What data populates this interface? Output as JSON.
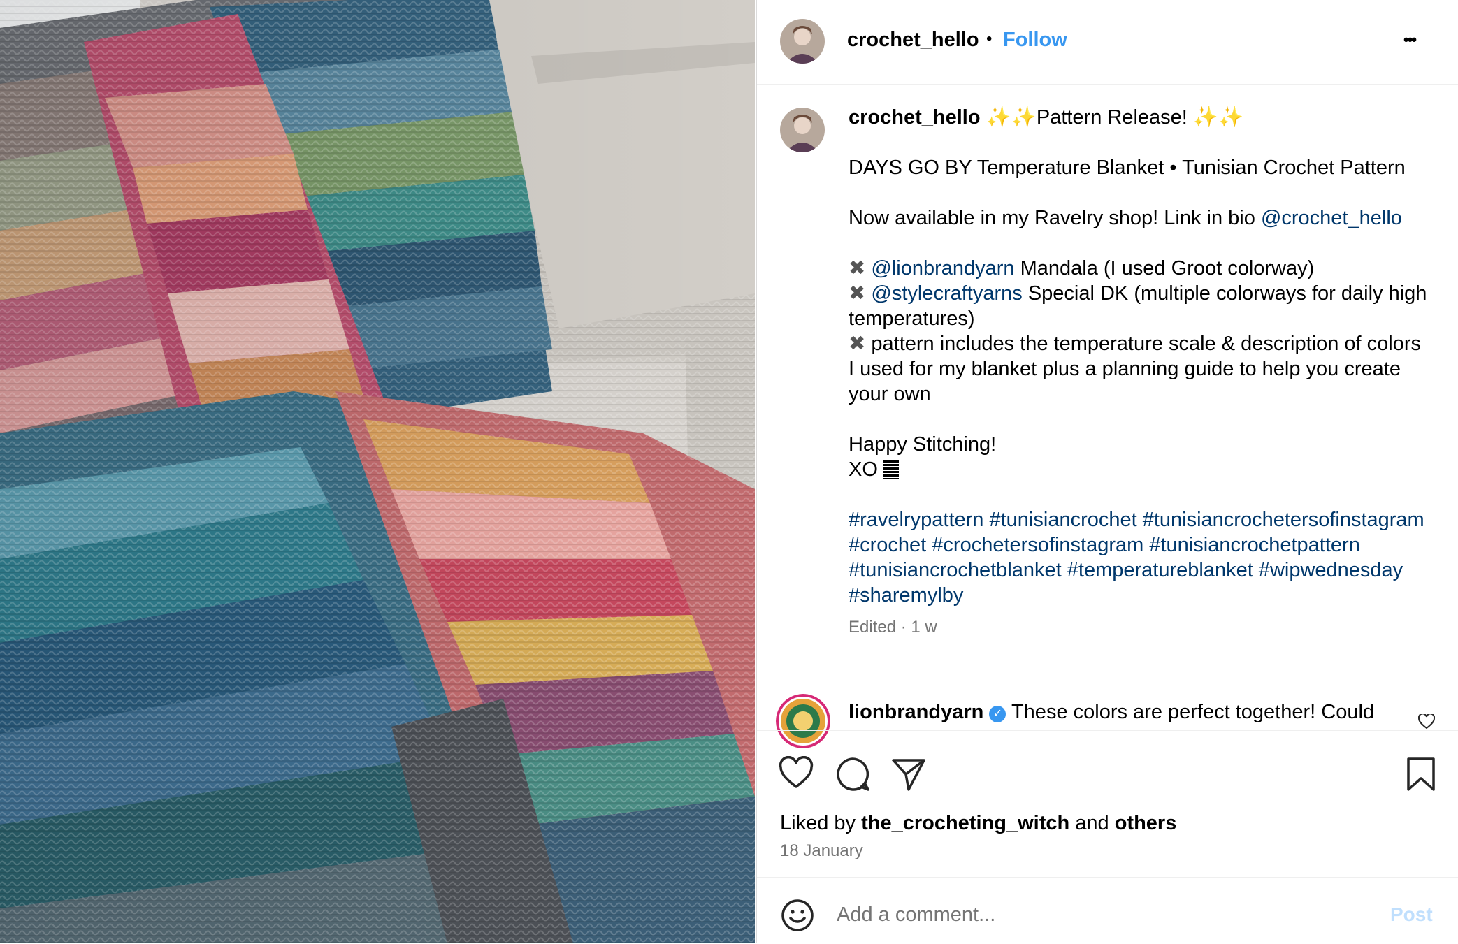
{
  "post": {
    "username": "crochet_hello",
    "follow_label": "Follow",
    "separator": "•",
    "more_label": "•••"
  },
  "caption": {
    "username": "crochet_hello",
    "headline": "✨✨Pattern Release! ✨✨",
    "title": "DAYS GO BY Temperature Blanket • Tunisian Crochet Pattern",
    "availability": "Now available in my Ravelry shop! Link in bio ",
    "availability_mention": "@crochet_hello",
    "bullet_symbol": "✖",
    "bullets": [
      {
        "mention": "@lionbrandyarn",
        "text": " Mandala (I used Groot colorway)"
      },
      {
        "mention": "@stylecraftyarns",
        "text": " Special DK (multiple colorways for daily high temperatures)"
      },
      {
        "mention": "",
        "text": "pattern includes the temperature scale & description of colors I used for my blanket plus a planning guide to help you create your own"
      }
    ],
    "signoff": "Happy Stitching!",
    "xo": "XO",
    "hashtags": "#ravelrypattern #tunisiancrochet #tunisiancrochetersofinstagram #crochet #crochetersofinstagram #tunisiancrochetpattern #tunisiancrochetblanket #temperatureblanket #wipwednesday #sharemylby",
    "meta": "Edited · 1 w"
  },
  "comment": {
    "username": "lionbrandyarn",
    "text": "These colors are perfect together! Could",
    "verified": true
  },
  "likes": {
    "prefix": "Liked by ",
    "user": "the_crocheting_witch",
    "middle": " and ",
    "others": "others",
    "date": "18 January"
  },
  "add_comment": {
    "placeholder": "Add a comment...",
    "post_label": "Post"
  },
  "colors": {
    "link": "#00376b",
    "follow": "#3897f0",
    "verified": "#3897f0"
  },
  "icons": [
    "heart-icon",
    "comment-icon",
    "share-icon",
    "bookmark-icon",
    "emoji-icon",
    "more-icon",
    "verified-icon"
  ]
}
